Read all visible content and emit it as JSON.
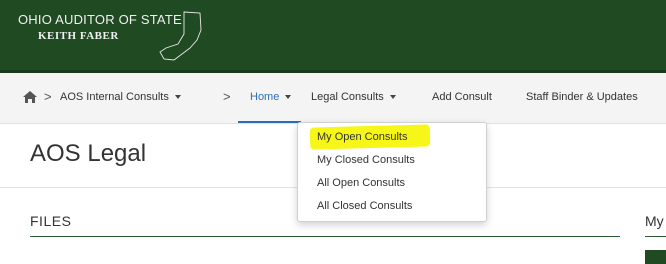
{
  "banner": {
    "logo_line1": "OHIO AUDITOR OF STATE",
    "logo_line2": "KEITH FABER",
    "bg_color": "#1f4a22"
  },
  "nav": {
    "home_icon": "home-icon",
    "separator": ">",
    "items": {
      "internal_consults": "AOS Internal Consults",
      "home": "Home",
      "legal_consults": "Legal Consults",
      "add_consult": "Add Consult",
      "staff_binder": "Staff Binder & Updates"
    },
    "active_color": "#2b6fb3"
  },
  "page": {
    "title": "AOS Legal",
    "files_heading": "FILES",
    "right_heading": "My"
  },
  "dropdown": {
    "items": [
      "My Open Consults",
      "My Closed Consults",
      "All Open Consults",
      "All Closed Consults"
    ],
    "highlighted_index": 0,
    "highlight_color": "#f6f500"
  }
}
